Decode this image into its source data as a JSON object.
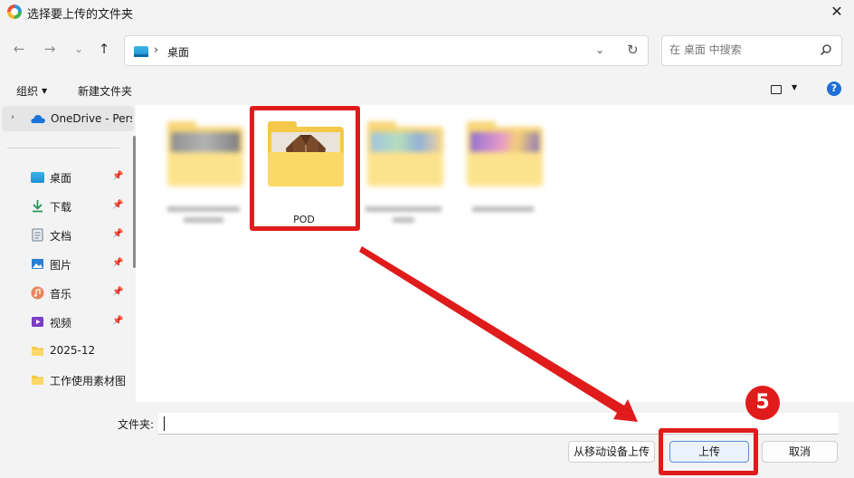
{
  "window": {
    "title": "选择要上传的文件夹",
    "close": "✕"
  },
  "nav": {
    "back": "←",
    "forward": "→",
    "recent": "⌄",
    "up": "↑"
  },
  "address": {
    "separator": "›",
    "location": "桌面",
    "dropdown": "⌄",
    "refresh": "↻"
  },
  "search": {
    "placeholder": "在 桌面 中搜索"
  },
  "toolbar": {
    "organize": "组织",
    "organize_caret": "▼",
    "new_folder": "新建文件夹",
    "view_caret": "▼",
    "help": "?"
  },
  "sidebar": {
    "onedrive": {
      "chevron": "›",
      "label": "OneDrive - Personal"
    },
    "items": [
      {
        "label": "桌面",
        "icon": "desktop-icon",
        "pinned": true
      },
      {
        "label": "下载",
        "icon": "download-icon",
        "pinned": true
      },
      {
        "label": "文档",
        "icon": "document-icon",
        "pinned": true
      },
      {
        "label": "图片",
        "icon": "picture-icon",
        "pinned": true
      },
      {
        "label": "音乐",
        "icon": "music-icon",
        "pinned": true
      },
      {
        "label": "视频",
        "icon": "video-icon",
        "pinned": true
      },
      {
        "label": "2025-12",
        "icon": "folder-icon",
        "pinned": false
      },
      {
        "label": "工作使用素材图",
        "icon": "folder-icon",
        "pinned": false
      }
    ],
    "pin_glyph": "📌"
  },
  "folders": [
    {
      "label": "",
      "blurred": true
    },
    {
      "label": "POD",
      "blurred": false
    },
    {
      "label": "",
      "blurred": true
    },
    {
      "label": "",
      "blurred": true
    }
  ],
  "bottom": {
    "filename_label": "文件夹:",
    "filename_value": "",
    "mobile_button": "从移动设备上传",
    "upload_button": "上传",
    "cancel_button": "取消"
  },
  "annotation": {
    "step": "5",
    "color": "#e01b1b"
  }
}
